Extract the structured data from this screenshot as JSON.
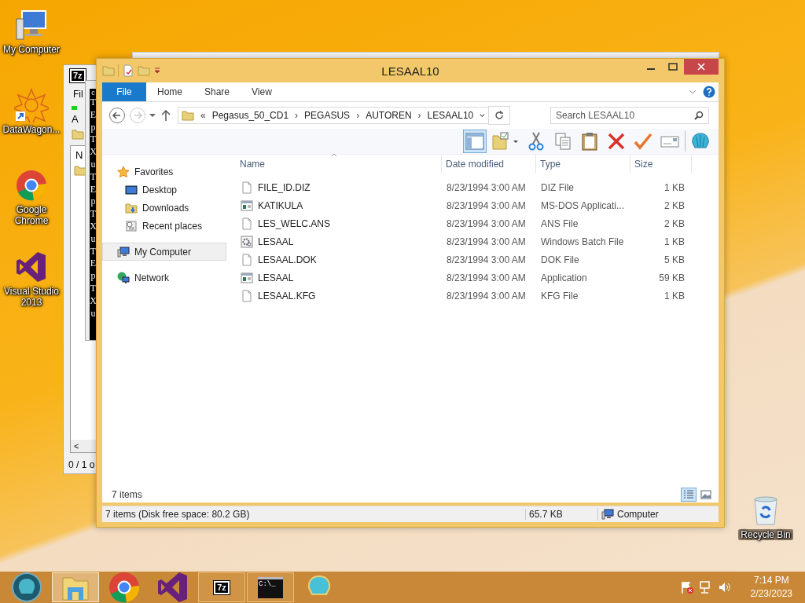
{
  "desktop_icons": [
    {
      "label": "My Computer",
      "kind": "computer"
    },
    {
      "label": "DataWagon...",
      "kind": "mandala"
    },
    {
      "label": "Google Chrome",
      "kind": "chrome"
    },
    {
      "label": "Visual Studio 2013",
      "kind": "vs"
    },
    {
      "label": "Recycle Bin",
      "kind": "recycle"
    }
  ],
  "background_windows": {
    "archiver": {
      "logo": "7z",
      "menu": "Fil",
      "toolbar_label": "A",
      "column": "N",
      "scroll_left": "<",
      "status": "0 / 1 o"
    },
    "console": {
      "logo": "c",
      "text": "TEpTXuTEpTXuTEpTXu"
    }
  },
  "window": {
    "title": "LESAAL10",
    "ribbon_tabs": [
      {
        "label": "File",
        "kind": "menu",
        "selected": false
      },
      {
        "label": "Home",
        "kind": "tab",
        "selected": false
      },
      {
        "label": "Share",
        "kind": "tab",
        "selected": false
      },
      {
        "label": "View",
        "kind": "tab",
        "selected": false
      }
    ],
    "address": {
      "overflow": "«",
      "path": [
        "Pegasus_50_CD1",
        "PEGASUS",
        "AUTOREN",
        "LESAAL10"
      ],
      "separator": "›"
    },
    "search": {
      "placeholder": "Search LESAAL10"
    },
    "toolbar": [
      {
        "kind": "preview_pane",
        "selected": true
      },
      {
        "kind": "folder_check",
        "selected": false
      },
      {
        "kind": "cut",
        "selected": false
      },
      {
        "kind": "copy",
        "selected": false
      },
      {
        "kind": "paste",
        "selected": false
      },
      {
        "kind": "delete",
        "selected": false
      },
      {
        "kind": "check",
        "selected": false
      },
      {
        "kind": "card",
        "selected": false
      },
      {
        "kind": "shell",
        "selected": false
      }
    ],
    "navigation": [
      {
        "label": "Favorites",
        "kind": "star",
        "selected": false,
        "children": [
          {
            "label": "Desktop",
            "kind": "desktop",
            "selected": false
          },
          {
            "label": "Downloads",
            "kind": "downloads",
            "selected": false
          },
          {
            "label": "Recent places",
            "kind": "recent",
            "selected": false
          }
        ]
      },
      {
        "label": "My Computer",
        "kind": "computer",
        "selected": true
      },
      {
        "label": "Network",
        "kind": "network",
        "selected": false
      }
    ],
    "table": {
      "columns": [
        "Name",
        "Date modified",
        "Type",
        "Size"
      ],
      "rows": [
        {
          "kind": "document",
          "selected": false,
          "cells": [
            "FILE_ID.DIZ",
            "8/23/1994 3:00 AM",
            "DIZ File",
            "1 KB"
          ]
        },
        {
          "kind": "app",
          "selected": false,
          "cells": [
            "KATIKULA",
            "8/23/1994 3:00 AM",
            "MS-DOS Applicati...",
            "2 KB"
          ]
        },
        {
          "kind": "document",
          "selected": false,
          "cells": [
            "LES_WELC.ANS",
            "8/23/1994 3:00 AM",
            "ANS File",
            "2 KB"
          ]
        },
        {
          "kind": "batch",
          "selected": false,
          "cells": [
            "LESAAL",
            "8/23/1994 3:00 AM",
            "Windows Batch File",
            "1 KB"
          ]
        },
        {
          "kind": "document",
          "selected": false,
          "cells": [
            "LESAAL.DOK",
            "8/23/1994 3:00 AM",
            "DOK File",
            "5 KB"
          ]
        },
        {
          "kind": "app",
          "selected": false,
          "cells": [
            "LESAAL",
            "8/23/1994 3:00 AM",
            "Application",
            "59 KB"
          ]
        },
        {
          "kind": "document",
          "selected": false,
          "cells": [
            "LESAAL.KFG",
            "8/23/1994 3:00 AM",
            "KFG File",
            "1 KB"
          ]
        }
      ]
    },
    "item_count": "7 items",
    "views": [
      {
        "kind": "details",
        "selected": true
      },
      {
        "kind": "thumbnails",
        "selected": false
      }
    ],
    "status_bar": {
      "summary": "7 items (Disk free space: 80.2 GB)",
      "size": "65.7 KB",
      "location": "Computer"
    }
  },
  "taskbar": {
    "items": [
      {
        "kind": "start",
        "active": false,
        "running": false
      },
      {
        "kind": "explorer",
        "active": true,
        "running": true
      },
      {
        "kind": "chrome",
        "active": false,
        "running": false
      },
      {
        "kind": "vs",
        "active": false,
        "running": false
      },
      {
        "kind": "archiver",
        "active": false,
        "running": true,
        "icon_text": "7z"
      },
      {
        "kind": "cmd",
        "active": false,
        "running": true,
        "icon_text": "C:\\_"
      },
      {
        "kind": "shell",
        "active": false,
        "running": false
      }
    ],
    "tray": [
      {
        "kind": "flag"
      },
      {
        "kind": "network"
      },
      {
        "kind": "volume"
      }
    ],
    "time": "7:14 PM",
    "date": "2/23/2023"
  }
}
